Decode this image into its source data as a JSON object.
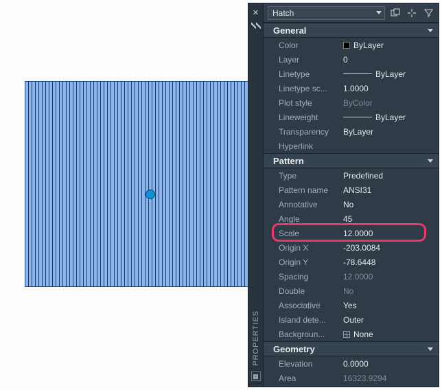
{
  "topbar": {
    "type_label": "Hatch"
  },
  "sections": {
    "general": {
      "title": "General",
      "rows": {
        "color": {
          "label": "Color",
          "value": "ByLayer"
        },
        "layer": {
          "label": "Layer",
          "value": "0"
        },
        "linetype": {
          "label": "Linetype",
          "value": "ByLayer"
        },
        "ltscale": {
          "label": "Linetype sc...",
          "value": "1.0000"
        },
        "plotstyle": {
          "label": "Plot style",
          "value": "ByColor"
        },
        "lineweight": {
          "label": "Lineweight",
          "value": "ByLayer"
        },
        "transparency": {
          "label": "Transparency",
          "value": "ByLayer"
        },
        "hyperlink": {
          "label": "Hyperlink",
          "value": ""
        }
      }
    },
    "pattern": {
      "title": "Pattern",
      "rows": {
        "type": {
          "label": "Type",
          "value": "Predefined"
        },
        "patternname": {
          "label": "Pattern name",
          "value": "ANSI31"
        },
        "annotative": {
          "label": "Annotative",
          "value": "No"
        },
        "angle": {
          "label": "Angle",
          "value": "45"
        },
        "scale": {
          "label": "Scale",
          "value": "12.0000"
        },
        "originx": {
          "label": "Origin X",
          "value": "-203.0084"
        },
        "originy": {
          "label": "Origin Y",
          "value": "-78.6448"
        },
        "spacing": {
          "label": "Spacing",
          "value": "12.0000"
        },
        "double": {
          "label": "Double",
          "value": "No"
        },
        "associative": {
          "label": "Associative",
          "value": "Yes"
        },
        "island": {
          "label": "Island dete...",
          "value": "Outer"
        },
        "background": {
          "label": "Backgroun...",
          "value": "None"
        }
      }
    },
    "geometry": {
      "title": "Geometry",
      "rows": {
        "elevation": {
          "label": "Elevation",
          "value": "0.0000"
        },
        "area": {
          "label": "Area",
          "value": "16323.9294"
        }
      }
    }
  },
  "gutter": {
    "panel_label": "PROPERTIES"
  }
}
